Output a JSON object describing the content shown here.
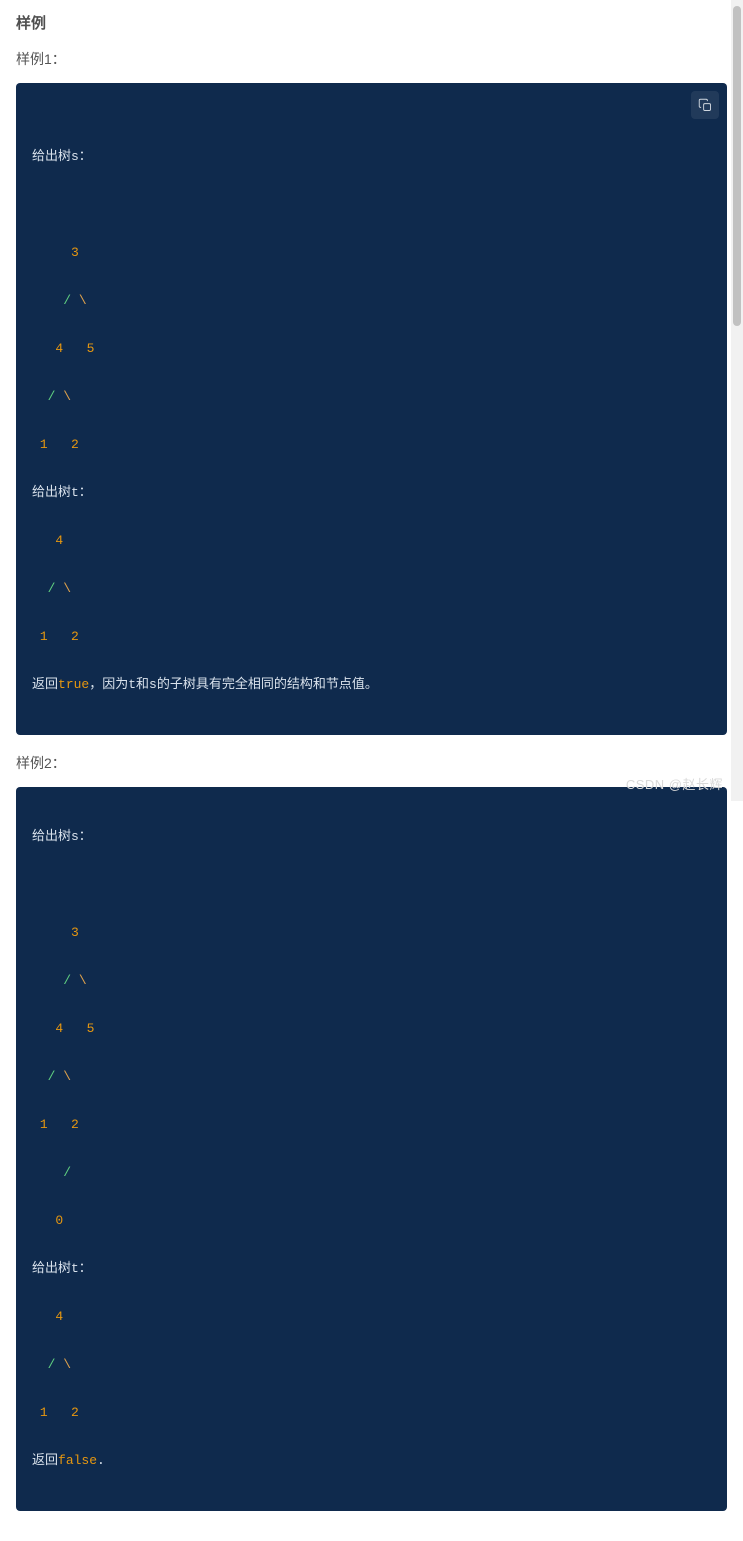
{
  "heading": "样例",
  "example1": {
    "title": "样例1：",
    "tree_s_label": "给出树s：",
    "tree_t_label": "给出树t：",
    "tree_s": {
      "n3": "3",
      "n4": "4",
      "n5": "5",
      "n1": "1",
      "n2": "2"
    },
    "tree_t": {
      "n4": "4",
      "n1": "1",
      "n2": "2"
    },
    "return_prefix": "返回",
    "return_value": "true",
    "return_suffix": "，因为t和s的子树具有完全相同的结构和节点值。",
    "slash": "/",
    "bslash": "\\"
  },
  "example2": {
    "title": "样例2：",
    "tree_s_label": "给出树s：",
    "tree_t_label": "给出树t：",
    "tree_s": {
      "n3": "3",
      "n4": "4",
      "n5": "5",
      "n1": "1",
      "n2": "2",
      "n0": "0"
    },
    "tree_t": {
      "n4": "4",
      "n1": "1",
      "n2": "2"
    },
    "return_prefix": "返回",
    "return_value": "false",
    "return_suffix": ".",
    "slash": "/",
    "bslash": "\\"
  },
  "watermark": "CSDN @赵长辉"
}
